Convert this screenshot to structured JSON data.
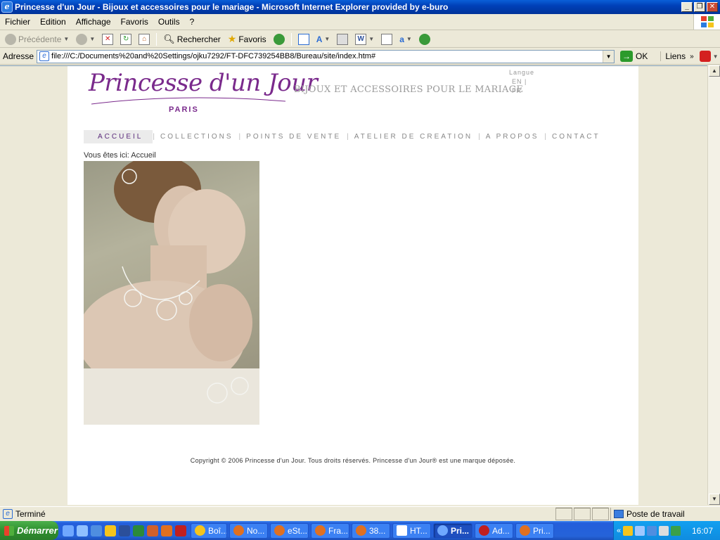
{
  "window": {
    "title": "Princesse d'un Jour - Bijoux et accessoires pour le mariage - Microsoft Internet Explorer provided by e-buro",
    "buttons": {
      "minimize": "_",
      "maximize": "❐",
      "close": "✕"
    }
  },
  "menu": {
    "items": [
      "Fichier",
      "Edition",
      "Affichage",
      "Favoris",
      "Outils",
      "?"
    ]
  },
  "toolbar": {
    "back_label": "Précédente",
    "search_label": "Rechercher",
    "favorites_label": "Favoris"
  },
  "address": {
    "label": "Adresse",
    "url": "file:///C:/Documents%20and%20Settings/ojku7292/FT-DFC739254BB8/Bureau/site/index.htm#",
    "go_label": "OK",
    "links_label": "Liens"
  },
  "site": {
    "logo_text": "Princesse d'un Jour",
    "logo_sub": "PARIS",
    "tagline": "BIJOUX ET ACCESSOIRES POUR LE MARIAGE",
    "langue_label": "Langue",
    "lang_en": "EN |",
    "lang_fr": "FR",
    "nav": [
      "ACCUEIL",
      "COLLECTIONS",
      "POINTS DE VENTE",
      "ATELIER DE CREATION",
      "A PROPOS",
      "CONTACT"
    ],
    "breadcrumb": "Vous êtes ici: Accueil",
    "copyright": "Copyright © 2006 Princesse d'un Jour. Tous droits réservés. Princesse d'un Jour® est une marque déposée."
  },
  "status": {
    "text": "Terminé",
    "zone": "Poste de travail"
  },
  "taskbar": {
    "start_label": "Démarrer",
    "tasks": [
      "Boî...",
      "No...",
      "eSt...",
      "Fra...",
      "38...",
      "HT...",
      "Pri...",
      "Ad...",
      "Pri..."
    ],
    "active_task_index": 6,
    "clock": "16:07"
  },
  "colors": {
    "brand_purple": "#7a2a8c",
    "xp_blue": "#0a5fd8",
    "start_green": "#2f8f2f"
  }
}
